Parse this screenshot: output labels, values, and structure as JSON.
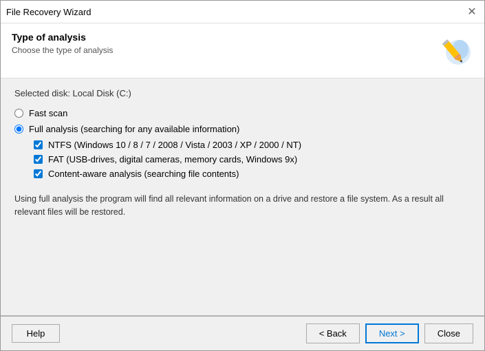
{
  "window": {
    "title": "File Recovery Wizard"
  },
  "header": {
    "title": "Type of analysis",
    "subtitle": "Choose the type of analysis"
  },
  "selected_disk_label": "Selected disk: Local Disk (C:)",
  "options": {
    "fast_scan_label": "Fast scan",
    "full_analysis_label": "Full analysis (searching for any available information)",
    "checkboxes": [
      {
        "label": "NTFS (Windows 10 / 8 / 7 / 2008 / Vista / 2003 / XP / 2000 / NT)",
        "checked": true
      },
      {
        "label": "FAT (USB-drives, digital cameras, memory cards, Windows 9x)",
        "checked": true
      },
      {
        "label": "Content-aware analysis (searching file contents)",
        "checked": true
      }
    ]
  },
  "description": "Using full analysis the program will find all relevant information on a drive and restore a file system. As a result all relevant files will be restored.",
  "buttons": {
    "help": "Help",
    "back": "< Back",
    "next": "Next >",
    "close": "Close"
  }
}
